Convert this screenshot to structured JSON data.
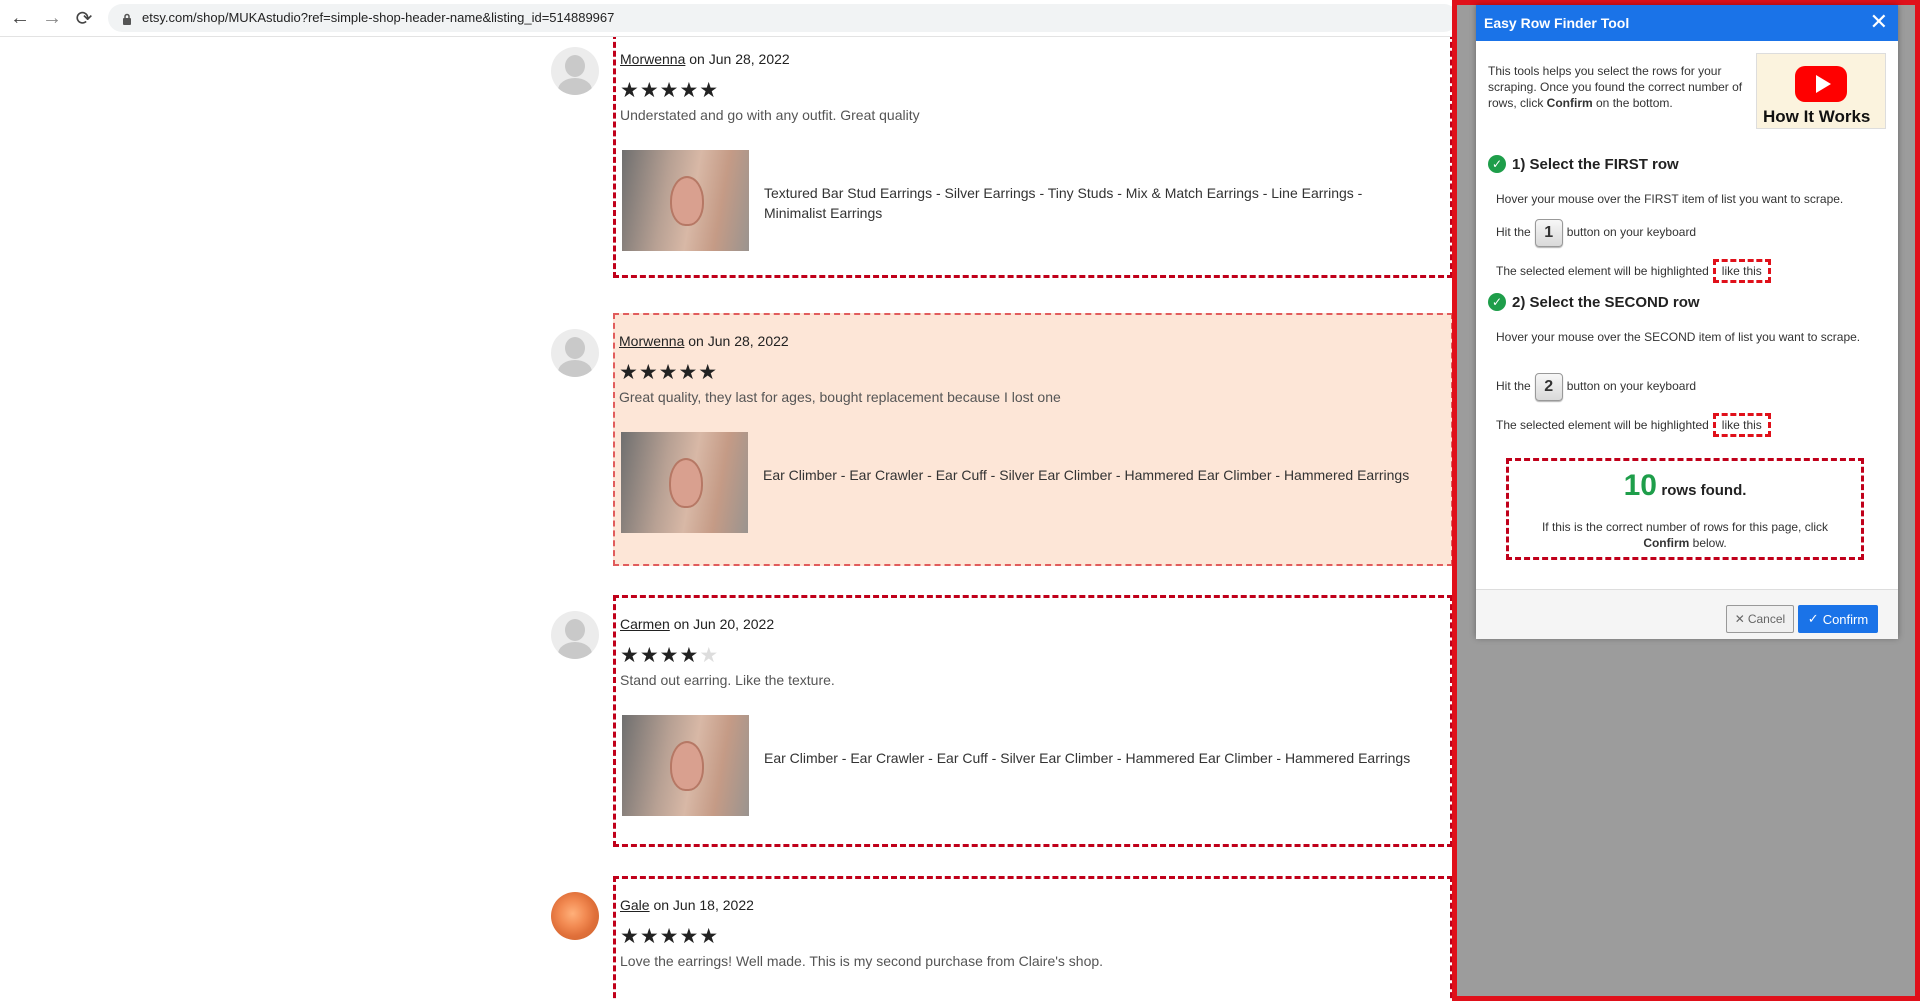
{
  "browser": {
    "url": "etsy.com/shop/MUKAstudio?ref=simple-shop-header-name&listing_id=514889967",
    "back_icon": "←",
    "forward_icon": "→",
    "reload_icon": "⟳"
  },
  "reviews": [
    {
      "reviewer": "Morwenna",
      "date": "on Jun 28, 2022",
      "rating": 5,
      "stars_on": "★★★★★",
      "stars_off": "",
      "text": "Understated and go with any outfit. Great quality",
      "listing": "Textured Bar Stud Earrings - Silver Earrings - Tiny Studs - Mix & Match Earrings - Line Earrings - Minimalist Earrings"
    },
    {
      "reviewer": "Morwenna",
      "date": "on Jun 28, 2022",
      "rating": 5,
      "stars_on": "★★★★★",
      "stars_off": "",
      "text": "Great quality, they last for ages, bought replacement because I lost one",
      "listing": "Ear Climber - Ear Crawler - Ear Cuff - Silver Ear Climber - Hammered Ear Climber - Hammered Earrings"
    },
    {
      "reviewer": "Carmen",
      "date": "on Jun 20, 2022",
      "rating": 4,
      "stars_on": "★★★★",
      "stars_off": "★",
      "text": "Stand out earring. Like the texture.",
      "listing": "Ear Climber - Ear Crawler - Ear Cuff - Silver Ear Climber - Hammered Ear Climber - Hammered Earrings"
    },
    {
      "reviewer": "Gale",
      "date": "on Jun 18, 2022",
      "rating": 5,
      "stars_on": "★★★★★",
      "stars_off": "",
      "text": "Love the earrings! Well made. This is my second purchase from Claire's shop.",
      "listing": ""
    }
  ],
  "dialog": {
    "title": "Easy Row Finder Tool",
    "close_icon": "✕",
    "intro_a": "This tools helps you select the rows for your scraping. Once you found the correct number of rows, click ",
    "intro_bold": "Confirm",
    "intro_b": " on the bottom.",
    "video_label": "How It Works",
    "step1": {
      "title": "1) Select the FIRST row",
      "hover": "Hover your mouse over the FIRST item of list you want to scrape.",
      "hit_prefix": "Hit the",
      "key": "1",
      "hit_suffix": "button on your keyboard",
      "highlight_text": "The selected element will be highlighted",
      "like_this": "like this"
    },
    "step2": {
      "title": "2) Select the SECOND row",
      "hover": "Hover your mouse over the SECOND item of list you want to scrape.",
      "hit_prefix": "Hit the",
      "key": "2",
      "hit_suffix": "button on your keyboard",
      "highlight_text": "The selected element will be highlighted",
      "like_this": "like this"
    },
    "found_count": "10",
    "found_label": "rows found.",
    "found_sub_a": "If this is the correct number of rows for this page, click ",
    "found_sub_bold": "Confirm",
    "found_sub_b": " below.",
    "cancel_label": "Cancel",
    "confirm_label": "Confirm",
    "check_icon": "✓"
  },
  "colors": {
    "highlight_border": "#c0001a",
    "highlight_fill": "#fde6d7",
    "dialog_header": "#1a73e8",
    "success": "#1e9e4a"
  }
}
